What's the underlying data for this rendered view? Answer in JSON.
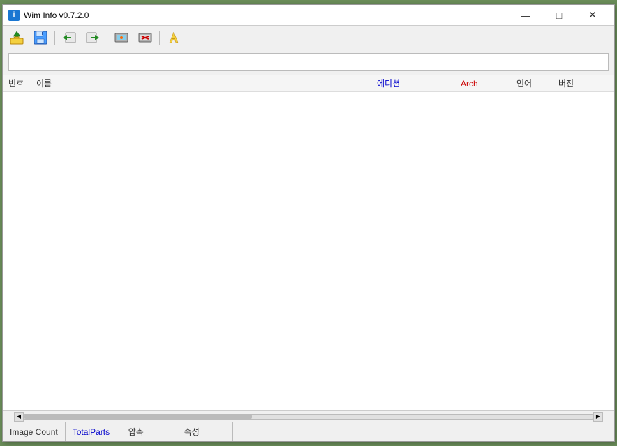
{
  "window": {
    "title": "Wim Info v0.7.2.0",
    "icon_label": "i"
  },
  "title_controls": {
    "minimize": "—",
    "maximize": "□",
    "close": "✕"
  },
  "toolbar": {
    "buttons": [
      {
        "name": "open-wim",
        "tooltip": "WIM 열기"
      },
      {
        "name": "save-wim",
        "tooltip": "WIM 저장"
      },
      {
        "name": "export-image",
        "tooltip": "이미지 내보내기"
      },
      {
        "name": "import-image",
        "tooltip": "이미지 가져오기"
      },
      {
        "name": "capture-image",
        "tooltip": "이미지 캡처"
      },
      {
        "name": "delete-image",
        "tooltip": "이미지 삭제"
      },
      {
        "name": "rename-image",
        "tooltip": "이름 변경"
      }
    ]
  },
  "address_bar": {
    "value": "",
    "placeholder": ""
  },
  "table": {
    "columns": [
      {
        "key": "번호",
        "label": "번호",
        "color": "normal"
      },
      {
        "key": "이름",
        "label": "이름",
        "color": "normal"
      },
      {
        "key": "에디션",
        "label": "에디션",
        "color": "blue"
      },
      {
        "key": "arch",
        "label": "Arch",
        "color": "red"
      },
      {
        "key": "언어",
        "label": "언어",
        "color": "normal"
      },
      {
        "key": "버전",
        "label": "버전",
        "color": "normal"
      }
    ],
    "rows": []
  },
  "status_bar": {
    "items": [
      {
        "key": "image_count",
        "label": "Image Count",
        "value": ""
      },
      {
        "key": "total_parts",
        "label": "TotalParts",
        "value": ""
      },
      {
        "key": "compression",
        "label": "압축",
        "value": ""
      },
      {
        "key": "properties",
        "label": "속성",
        "value": ""
      }
    ]
  }
}
